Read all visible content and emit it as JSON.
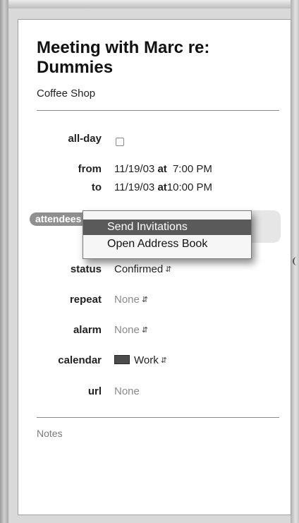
{
  "event": {
    "title": "Meeting with Marc re: Dummies",
    "location": "Coffee Shop",
    "all_day_label": "all-day",
    "from_label": "from",
    "from_date": "11/19/03",
    "from_at": "at",
    "from_time": "7:00 PM",
    "to_label": "to",
    "to_date": "11/19/03",
    "to_at": "at",
    "to_time": "10:00 PM",
    "attendees_label": "attendees",
    "status_label": "status",
    "status_value": "Confirmed",
    "repeat_label": "repeat",
    "repeat_value": "None",
    "alarm_label": "alarm",
    "alarm_value": "None",
    "calendar_label": "calendar",
    "calendar_value": "Work",
    "calendar_color": "#4b4b4b",
    "url_label": "url",
    "url_value": "None",
    "notes_placeholder": "Notes"
  },
  "context_menu": {
    "items": [
      {
        "label": "Send Invitations",
        "highlighted": true
      },
      {
        "label": "Open Address Book",
        "highlighted": false
      }
    ]
  },
  "icons": {
    "popup_arrows": "updown-arrows-icon",
    "checkbox": "checkbox-icon"
  },
  "colors": {
    "menu_highlight": "#5a5a5a",
    "attendee_token": "#8f8f8f"
  }
}
